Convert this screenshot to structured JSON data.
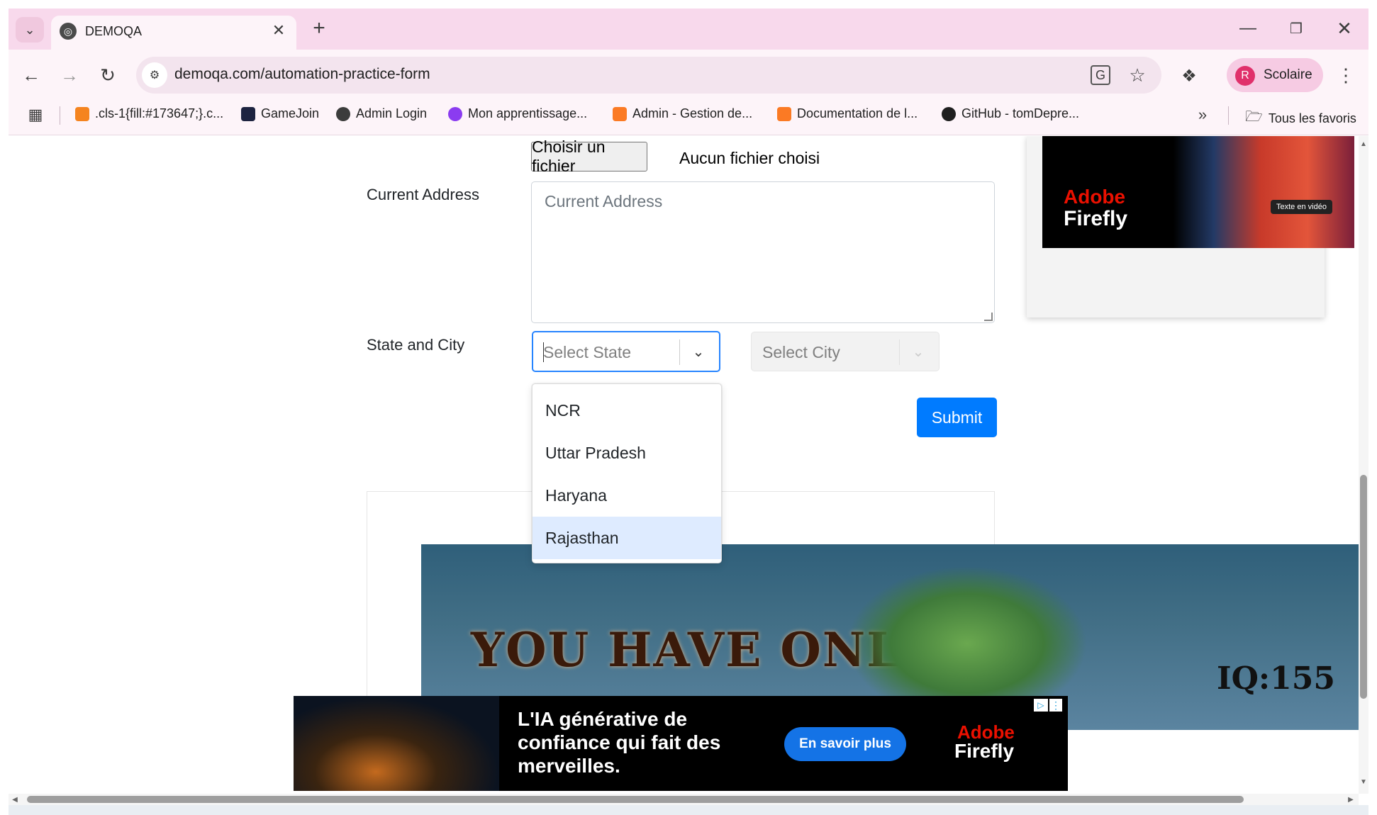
{
  "browser": {
    "tab_title": "DEMOQA",
    "url": "demoqa.com/automation-practice-form",
    "profile_initial": "R",
    "profile_name": "Scolaire",
    "bookmarks": [
      ".cls-1{fill:#173647;}.c...",
      "GameJoin",
      "Admin Login",
      "Mon apprentissage...",
      "Admin - Gestion de...",
      "Documentation de l...",
      "GitHub - tomDepre..."
    ],
    "all_bookmarks": "Tous les favoris"
  },
  "form": {
    "file_button": "Choisir un fichier",
    "file_status": "Aucun fichier choisi",
    "address_label": "Current Address",
    "address_placeholder": "Current Address",
    "state_city_label": "State and City",
    "state_placeholder": "Select State",
    "city_placeholder": "Select City",
    "state_options": [
      "NCR",
      "Uttar Pradesh",
      "Haryana",
      "Rajasthan"
    ],
    "highlighted_option": "Rajasthan",
    "submit": "Submit"
  },
  "ads": {
    "top_right_brand_line1": "Adobe",
    "top_right_brand_line2": "Firefly",
    "top_right_badge": "Texte en vidéo",
    "game_text": "YOU HAVE ONLY",
    "game_counter": "IQ:155",
    "bottom_text": "L'IA générative de confiance qui fait des merveilles.",
    "bottom_cta": "En savoir plus",
    "bottom_brand_line1": "Adobe",
    "bottom_brand_line2": "Firefly"
  },
  "colors": {
    "accent": "#007bff",
    "chrome_pink": "#f8d9ec",
    "adobe_red": "#eb1000"
  }
}
